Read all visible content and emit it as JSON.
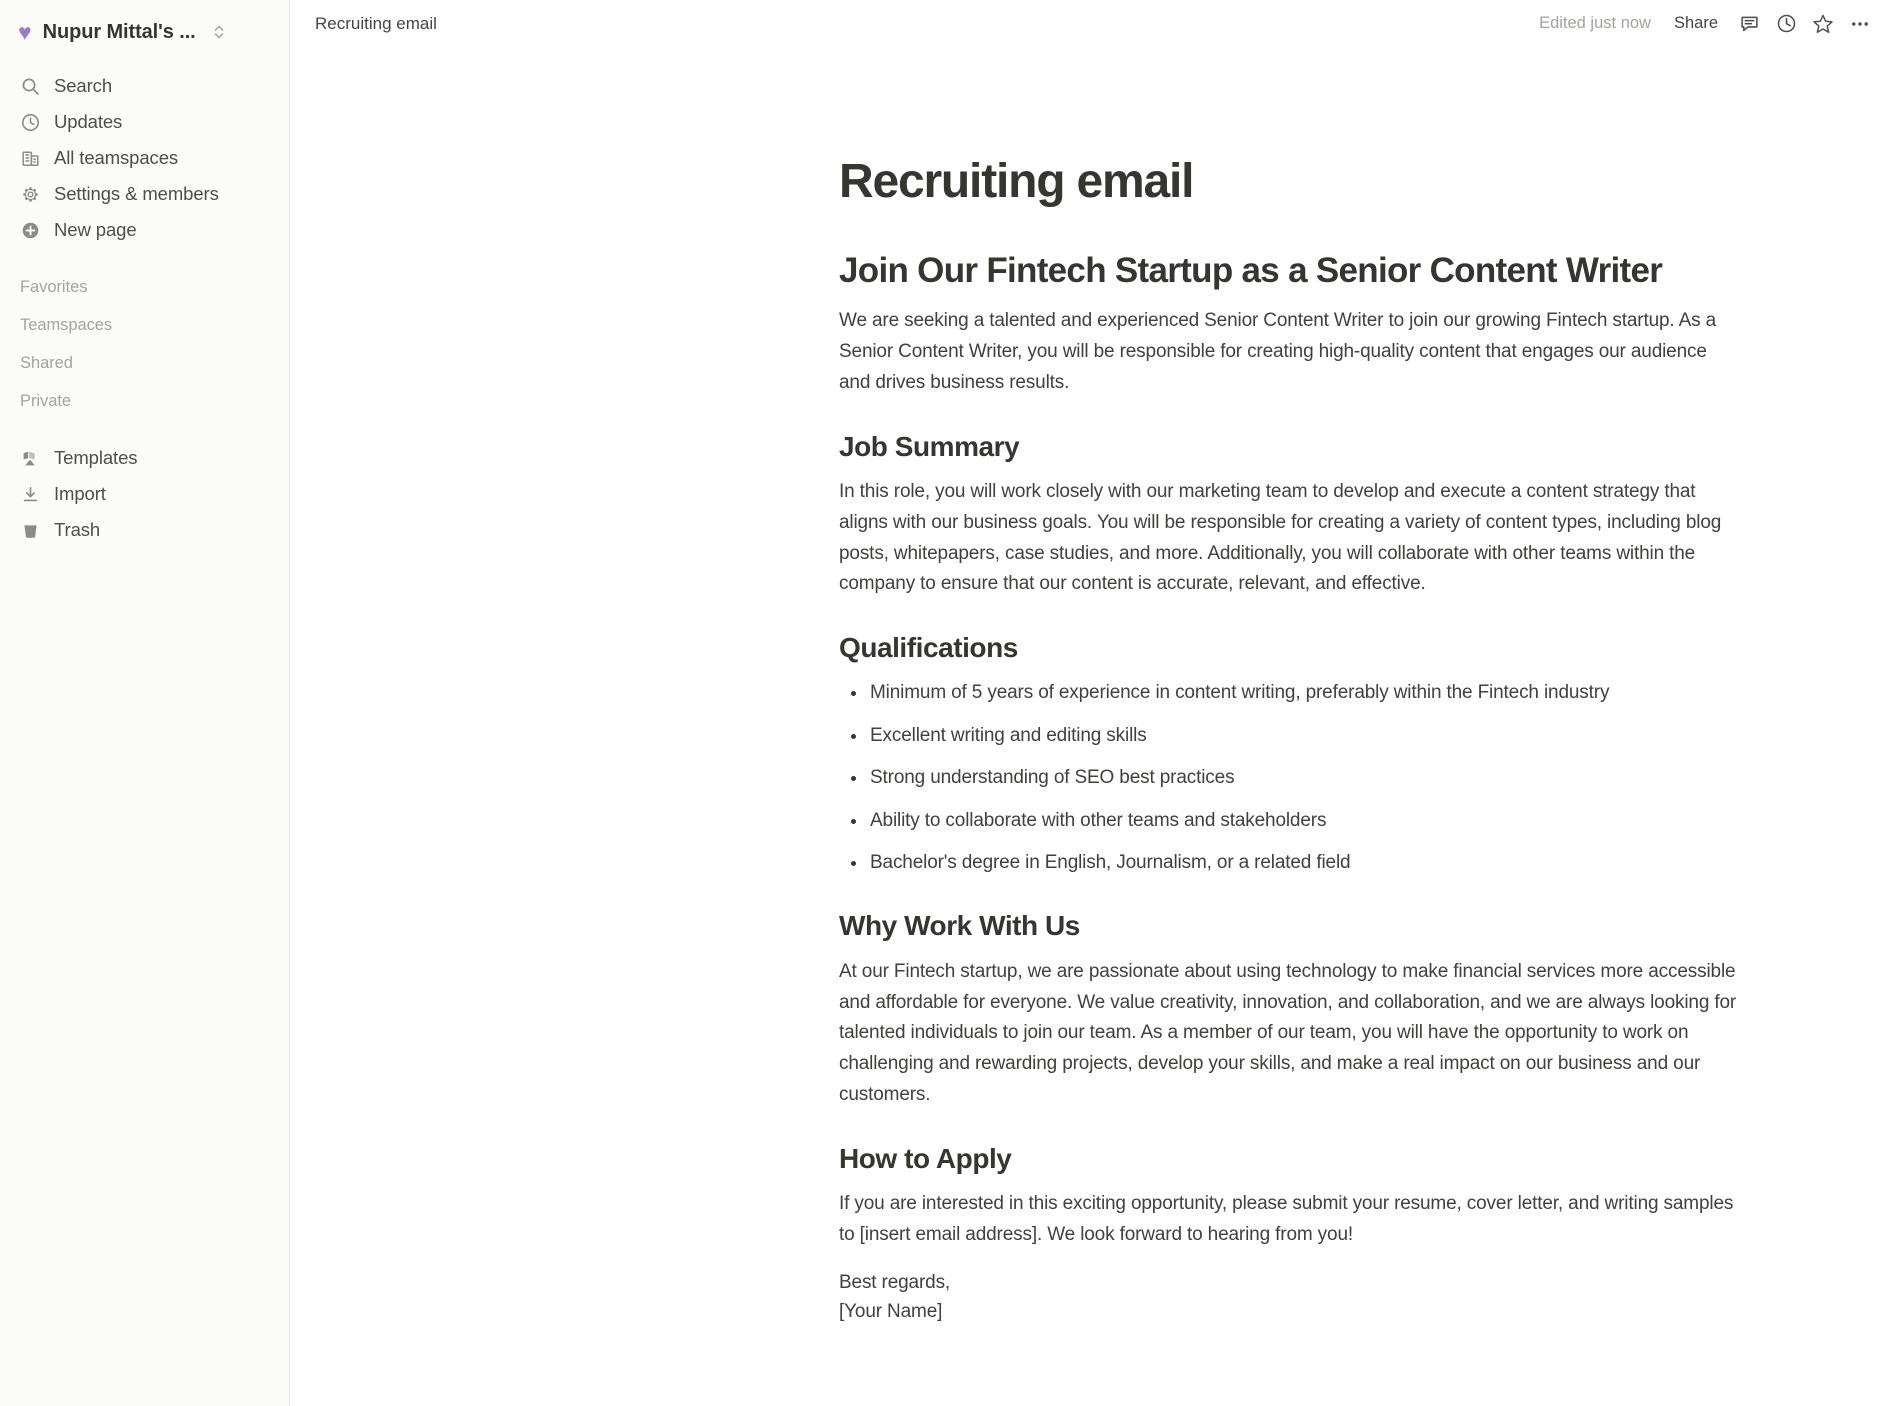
{
  "sidebar": {
    "workspace": {
      "emoji": "♥",
      "name": "Nupur Mittal's ...",
      "emoji_color": "#9a7bd1"
    },
    "nav_items": [
      {
        "icon": "search-icon",
        "label": "Search"
      },
      {
        "icon": "clock-icon",
        "label": "Updates"
      },
      {
        "icon": "building-icon",
        "label": "All teamspaces"
      },
      {
        "icon": "gear-icon",
        "label": "Settings & members"
      },
      {
        "icon": "plus-circle-icon",
        "label": "New page"
      }
    ],
    "sections": [
      {
        "label": "Favorites"
      },
      {
        "label": "Teamspaces"
      },
      {
        "label": "Shared"
      },
      {
        "label": "Private"
      }
    ],
    "bottom_items": [
      {
        "icon": "templates-icon",
        "label": "Templates"
      },
      {
        "icon": "import-icon",
        "label": "Import"
      },
      {
        "icon": "trash-icon",
        "label": "Trash"
      }
    ]
  },
  "topbar": {
    "breadcrumb": "Recruiting email",
    "edited_status": "Edited just now",
    "share_label": "Share",
    "icons": [
      {
        "name": "comment-icon"
      },
      {
        "name": "history-clock-icon"
      },
      {
        "name": "star-icon"
      },
      {
        "name": "more-options-icon"
      }
    ]
  },
  "document": {
    "title": "Recruiting email",
    "heading1": "Join Our Fintech Startup as a Senior Content Writer",
    "intro_paragraph": "We are seeking a talented and experienced Senior Content Writer to join our growing Fintech startup. As a Senior Content Writer, you will be responsible for creating high-quality content that engages our audience and drives business results.",
    "job_summary": {
      "heading": "Job Summary",
      "paragraph": "In this role, you will work closely with our marketing team to develop and execute a content strategy that aligns with our business goals. You will be responsible for creating a variety of content types, including blog posts, whitepapers, case studies, and more. Additionally, you will collaborate with other teams within the company to ensure that our content is accurate, relevant, and effective."
    },
    "qualifications": {
      "heading": "Qualifications",
      "items": [
        "Minimum of 5 years of experience in content writing, preferably within the Fintech industry",
        "Excellent writing and editing skills",
        "Strong understanding of SEO best practices",
        "Ability to collaborate with other teams and stakeholders",
        "Bachelor's degree in English, Journalism, or a related field"
      ]
    },
    "why_work": {
      "heading": "Why Work With Us",
      "paragraph": "At our Fintech startup, we are passionate about using technology to make financial services more accessible and affordable for everyone. We value creativity, innovation, and collaboration, and we are always looking for talented individuals to join our team. As a member of our team, you will have the opportunity to work on challenging and rewarding projects, develop your skills, and make a real impact on our business and our customers."
    },
    "how_to_apply": {
      "heading": "How to Apply",
      "paragraph": "If you are interested in this exciting opportunity, please submit your resume, cover letter, and writing samples to [insert email address]. We look forward to hearing from you!",
      "signoff": "Best regards,",
      "signature": "[Your Name]"
    }
  },
  "colors": {
    "sidebar_bg": "#fbfbfa",
    "text_primary": "#37352f",
    "text_secondary": "#4e4d4a",
    "text_muted": "#a5a39e",
    "accent_purple": "#9a7bd1"
  }
}
